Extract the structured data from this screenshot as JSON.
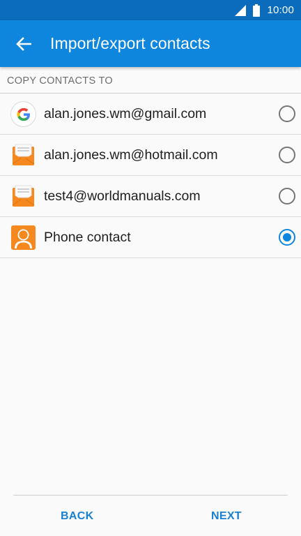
{
  "status_bar": {
    "time": "10:00",
    "signal_icon": "signal-icon",
    "battery_icon": "battery-icon"
  },
  "app_bar": {
    "title": "Import/export contacts",
    "back_icon": "back-arrow-icon"
  },
  "section": {
    "header": "COPY CONTACTS TO"
  },
  "accounts": [
    {
      "label": "alan.jones.wm@gmail.com",
      "icon": "google-icon",
      "selected": false
    },
    {
      "label": "alan.jones.wm@hotmail.com",
      "icon": "email-icon",
      "selected": false
    },
    {
      "label": "test4@worldmanuals.com",
      "icon": "email-icon",
      "selected": false
    },
    {
      "label": "Phone contact",
      "icon": "phone-contact-icon",
      "selected": true
    }
  ],
  "footer": {
    "back_label": "BACK",
    "next_label": "NEXT"
  },
  "colors": {
    "status_bar": "#0b6bbd",
    "app_bar": "#0f86de",
    "accent": "#0f86de",
    "button_text": "#1a80d2",
    "email_orange": "#f5891f"
  }
}
